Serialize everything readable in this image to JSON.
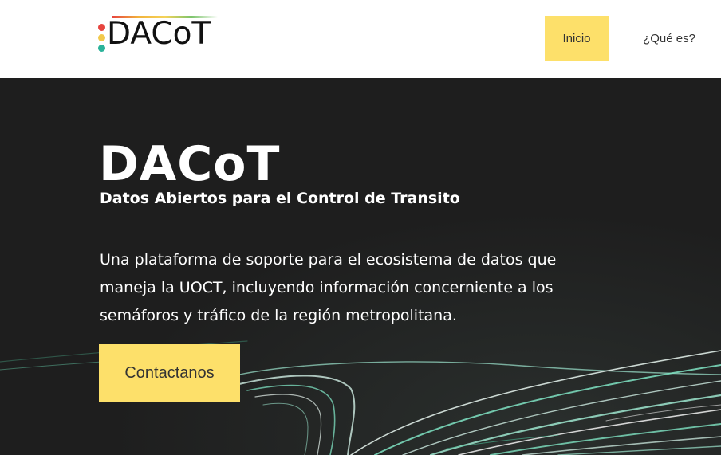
{
  "header": {
    "logo_text": "DACoT",
    "nav": [
      {
        "label": "Inicio",
        "active": true
      },
      {
        "label": "¿Qué es?",
        "active": false
      }
    ]
  },
  "hero": {
    "title": "DACoT",
    "subtitle": "Datos Abiertos para el Control de Transito",
    "description": "Una plataforma de soporte para el ecosistema de datos que maneja la UOCT, incluyendo información concerniente a los semáforos y tráfico de la región metropolitana.",
    "cta_label": "Contactanos"
  },
  "colors": {
    "accent": "#fde06a",
    "hero_bg": "#1e1e1e",
    "light_trail": "#7fe3c3"
  }
}
